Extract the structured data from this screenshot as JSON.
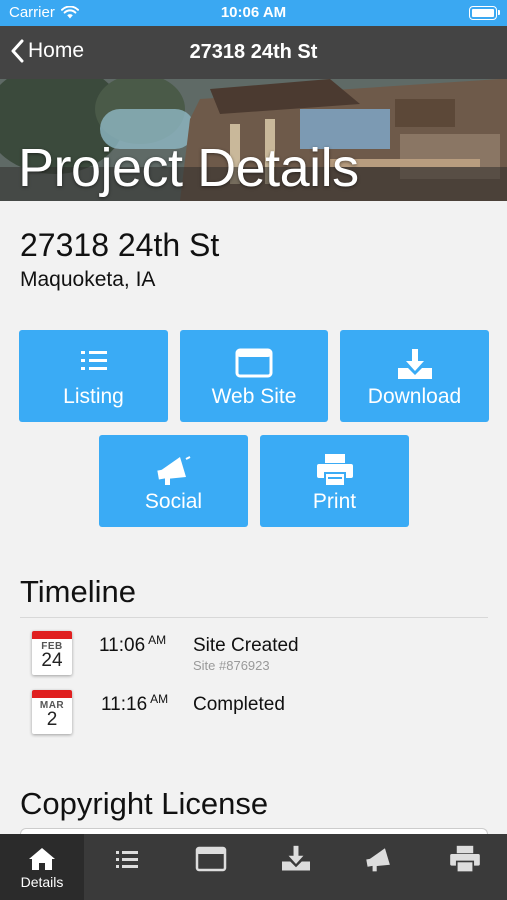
{
  "status_bar": {
    "carrier": "Carrier",
    "time": "10:06 AM"
  },
  "nav": {
    "back_label": "Home",
    "title": "27318 24th St"
  },
  "hero": {
    "title": "Project Details"
  },
  "project": {
    "address": "27318 24th St",
    "city": "Maquoketa, IA"
  },
  "actions": [
    {
      "label": "Listing",
      "icon": "list-icon"
    },
    {
      "label": "Web Site",
      "icon": "browser-window-icon"
    },
    {
      "label": "Download",
      "icon": "download-icon"
    },
    {
      "label": "Social",
      "icon": "megaphone-icon"
    },
    {
      "label": "Print",
      "icon": "printer-icon"
    }
  ],
  "timeline": {
    "title": "Timeline",
    "items": [
      {
        "month": "FEB",
        "day": "24",
        "time": "11:06",
        "ampm": "AM",
        "event": "Site Created",
        "sub": "Site #876923"
      },
      {
        "month": "MAR",
        "day": "2",
        "time": "11:16",
        "ampm": "AM",
        "event": "Completed",
        "sub": ""
      }
    ]
  },
  "copyright": {
    "title": "Copyright License"
  },
  "tab_bar": {
    "items": [
      {
        "label": "Details",
        "icon": "home-icon",
        "active": true
      },
      {
        "label": "",
        "icon": "list-icon"
      },
      {
        "label": "",
        "icon": "browser-window-icon"
      },
      {
        "label": "",
        "icon": "download-icon"
      },
      {
        "label": "",
        "icon": "megaphone-icon"
      },
      {
        "label": "",
        "icon": "printer-icon"
      }
    ]
  },
  "colors": {
    "accent": "#3aabf5",
    "status_bar": "#3aa8f2",
    "nav_bar": "#444444",
    "tab_bar": "#3a3a3a",
    "calendar_red": "#e02020"
  }
}
